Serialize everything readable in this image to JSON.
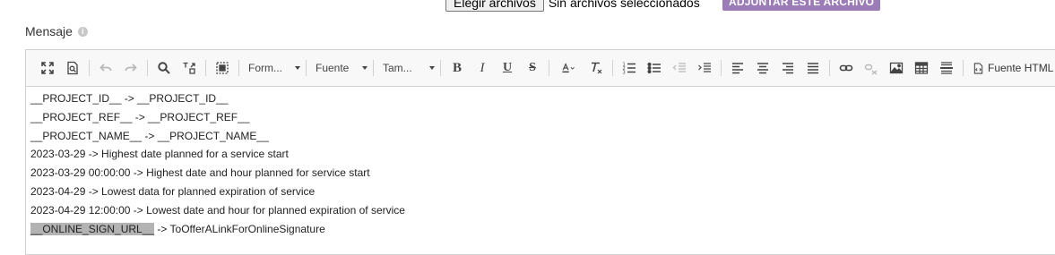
{
  "upload": {
    "choose_label": "Elegir archivos",
    "status": "Sin archivos seleccionados",
    "attach_label": "ADJUNTAR ESTE ARCHIVO"
  },
  "field": {
    "label": "Mensaje",
    "info_glyph": "i"
  },
  "toolbar": {
    "format_label": "Form...",
    "font_label": "Fuente",
    "size_label": "Tam...",
    "bold_glyph": "B",
    "italic_glyph": "I",
    "underline_glyph": "U",
    "strike_glyph": "S",
    "source_label": "Fuente HTML"
  },
  "content": {
    "lines": [
      {
        "text": "__PROJECT_ID__ -> __PROJECT_ID__"
      },
      {
        "text": "__PROJECT_REF__ -> __PROJECT_REF__"
      },
      {
        "text": "__PROJECT_NAME__ -> __PROJECT_NAME__"
      },
      {
        "text": "2023-03-29 -> Highest date planned for a service start"
      },
      {
        "text": "2023-03-29 00:00:00 -> Highest date and hour planned for service start"
      },
      {
        "text": "2023-04-29 -> Lowest data for planned expiration of service"
      },
      {
        "text": "2023-04-29 12:00:00 -> Lowest date and hour for planned expiration of service"
      },
      {
        "highlight": "__ONLINE_SIGN_URL__",
        "rest": " -> ToOfferALinkForOnlineSignature"
      }
    ]
  },
  "colors": {
    "attach_button": "#9b7cb6",
    "toolbar_bg": "#f8f8f8",
    "highlight": "#b3b3b3"
  }
}
